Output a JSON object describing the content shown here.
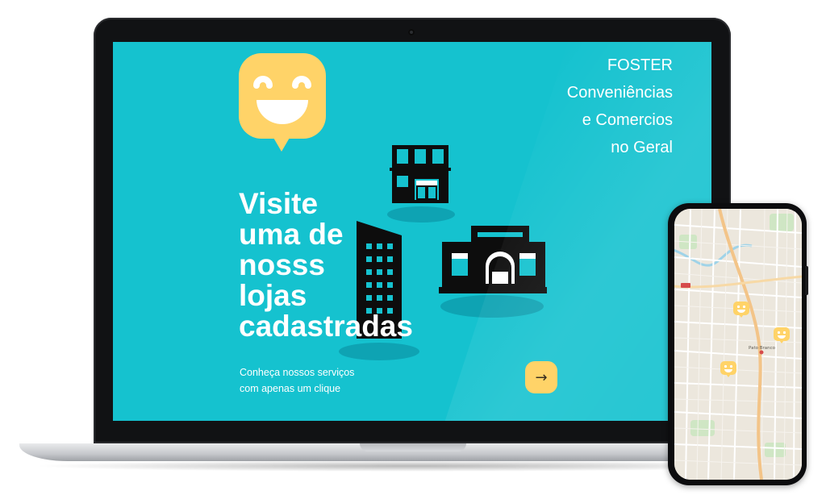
{
  "brand": {
    "lines": [
      "FOSTER",
      "Conveniências",
      "e Comercios",
      "no Geral"
    ]
  },
  "hero": {
    "headline_lines": [
      "Visite",
      "uma de",
      "nosss",
      "lojas",
      "cadastradas"
    ],
    "subtext_lines": [
      "Conheça nossos serviços",
      "com apenas um clique"
    ],
    "next_button_icon": "→"
  },
  "map": {
    "label": "Pato Branco"
  },
  "colors": {
    "screen_bg": "#15c2cf",
    "accent_yellow": "#ffd368",
    "building": "#0d0d0d",
    "building_shadow": "#0ea3b3",
    "text": "#ffffff"
  },
  "icons": {
    "logo": "smiley-speech-bubble-icon",
    "next": "arrow-right-icon",
    "map_marker": "smiley-map-marker-icon",
    "buildings": [
      "townhouse-building-icon",
      "tower-building-icon",
      "storefront-building-icon"
    ]
  }
}
